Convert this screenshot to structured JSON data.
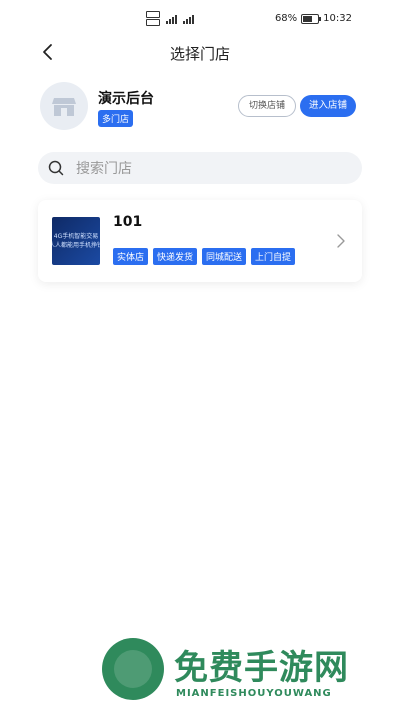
{
  "status_bar": {
    "battery_percent": "68%",
    "time": "10:32"
  },
  "header": {
    "title": "选择门店"
  },
  "account": {
    "name": "演示后台",
    "badge": "多门店",
    "switch_button": "切换店铺",
    "enter_button": "进入店铺"
  },
  "search": {
    "placeholder": "搜索门店"
  },
  "stores": [
    {
      "name": "101",
      "thumb_lines": [
        "4G手机智能交易",
        "人人都能用手机挣钱"
      ],
      "tags": [
        "实体店",
        "快递发货",
        "同城配送",
        "上门自提"
      ]
    }
  ],
  "watermark": {
    "title": "免费手游网",
    "subtitle": "MIANFEISHOUYOUWANG"
  },
  "colors": {
    "accent": "#2b6ef0",
    "watermark": "#2f8a5c"
  }
}
